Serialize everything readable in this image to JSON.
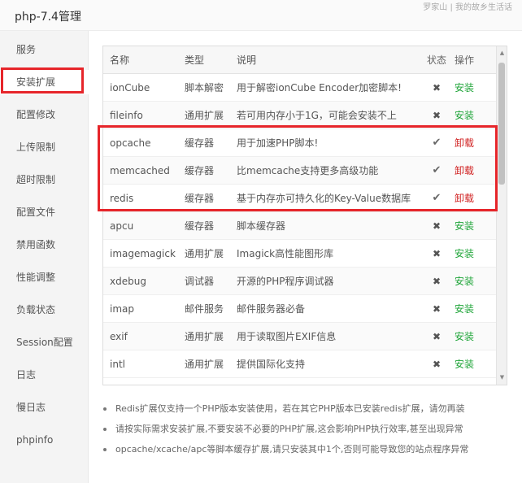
{
  "window": {
    "title": "php-7.4管理",
    "top_right": "罗家山 | 我的故乡生活话"
  },
  "sidebar": {
    "active_index": 1,
    "items": [
      {
        "label": "服务"
      },
      {
        "label": "安装扩展"
      },
      {
        "label": "配置修改"
      },
      {
        "label": "上传限制"
      },
      {
        "label": "超时限制"
      },
      {
        "label": "配置文件"
      },
      {
        "label": "禁用函数"
      },
      {
        "label": "性能调整"
      },
      {
        "label": "负载状态"
      },
      {
        "label": "Session配置"
      },
      {
        "label": "日志"
      },
      {
        "label": "慢日志"
      },
      {
        "label": "phpinfo"
      }
    ]
  },
  "table": {
    "headers": {
      "name": "名称",
      "type": "类型",
      "desc": "说明",
      "status": "状态",
      "action": "操作"
    },
    "rows": [
      {
        "name": "ionCube",
        "type": "脚本解密",
        "desc": "用于解密ionCube Encoder加密脚本!",
        "status": "✖",
        "installed": false,
        "action": "安装"
      },
      {
        "name": "fileinfo",
        "type": "通用扩展",
        "desc": "若可用内存小于1G，可能会安装不上",
        "status": "✖",
        "installed": false,
        "action": "安装"
      },
      {
        "name": "opcache",
        "type": "缓存器",
        "desc": "用于加速PHP脚本!",
        "status": "✔",
        "installed": true,
        "action": "卸载"
      },
      {
        "name": "memcached",
        "type": "缓存器",
        "desc": "比memcache支持更多高级功能",
        "status": "✔",
        "installed": true,
        "action": "卸载"
      },
      {
        "name": "redis",
        "type": "缓存器",
        "desc": "基于内存亦可持久化的Key-Value数据库",
        "status": "✔",
        "installed": true,
        "action": "卸载"
      },
      {
        "name": "apcu",
        "type": "缓存器",
        "desc": "脚本缓存器",
        "status": "✖",
        "installed": false,
        "action": "安装"
      },
      {
        "name": "imagemagick",
        "type": "通用扩展",
        "desc": "Imagick高性能图形库",
        "status": "✖",
        "installed": false,
        "action": "安装"
      },
      {
        "name": "xdebug",
        "type": "调试器",
        "desc": "开源的PHP程序调试器",
        "status": "✖",
        "installed": false,
        "action": "安装"
      },
      {
        "name": "imap",
        "type": "邮件服务",
        "desc": "邮件服务器必备",
        "status": "✖",
        "installed": false,
        "action": "安装"
      },
      {
        "name": "exif",
        "type": "通用扩展",
        "desc": "用于读取图片EXIF信息",
        "status": "✖",
        "installed": false,
        "action": "安装"
      },
      {
        "name": "intl",
        "type": "通用扩展",
        "desc": "提供国际化支持",
        "status": "✖",
        "installed": false,
        "action": "安装"
      }
    ]
  },
  "notes": [
    "Redis扩展仅支持一个PHP版本安装使用，若在其它PHP版本已安装redis扩展，请勿再装",
    "请按实际需求安装扩展,不要安装不必要的PHP扩展,这会影响PHP执行效率,甚至出现异常",
    "opcache/xcache/apc等脚本缓存扩展,请只安装其中1个,否则可能导致您的站点程序异常"
  ],
  "colors": {
    "highlight": "#e6252a",
    "install": "#20a53a",
    "uninstall": "#d02020"
  }
}
